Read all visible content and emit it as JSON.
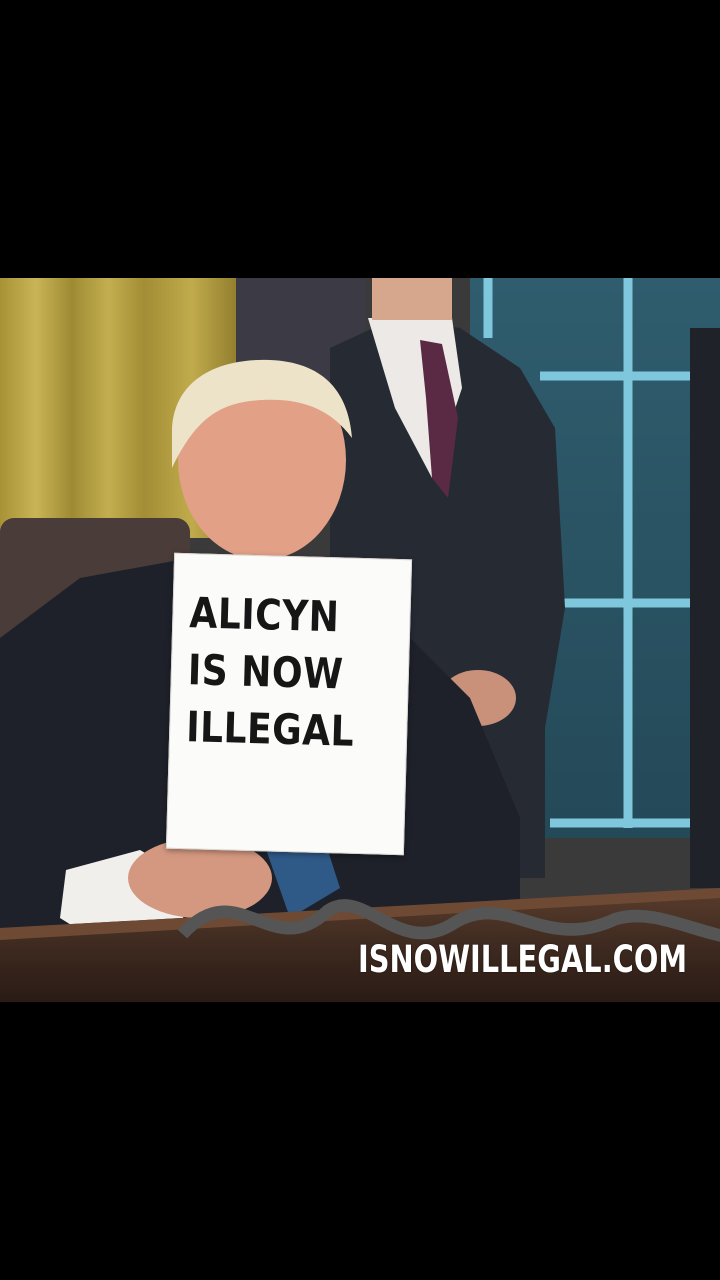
{
  "image": {
    "sign": {
      "lines": [
        "ALICYN",
        "IS NOW",
        "ILLEGAL"
      ],
      "text_color": "#161616",
      "paper_color": "#fbfbfa"
    },
    "watermark": "ISNOWILLEGAL.COM",
    "colors": {
      "background": "#000000",
      "curtain": "#b9a54a",
      "window": "#2e5a6b",
      "suit": "#22252e",
      "desk": "#4a3326"
    }
  }
}
